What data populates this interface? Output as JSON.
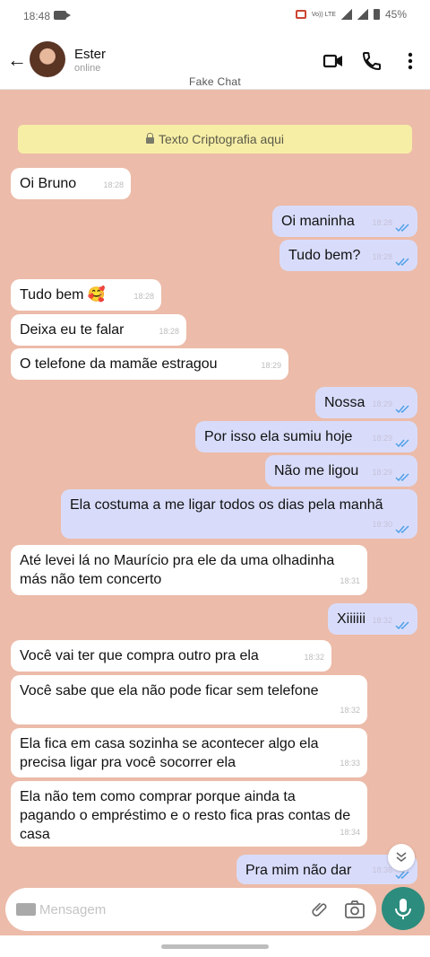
{
  "status_bar": {
    "time": "18:48",
    "network": "Vo)) LTE",
    "battery": "45%"
  },
  "header": {
    "contact_name": "Ester",
    "contact_status": "online",
    "app_label": "Fake Chat"
  },
  "encryption_banner": "Texto Criptografia aqui",
  "messages": [
    {
      "dir": "in",
      "text": "Oi Bruno",
      "time": "18:28"
    },
    {
      "dir": "out",
      "text": "Oi maninha",
      "time": "18:28"
    },
    {
      "dir": "out",
      "text": "Tudo bem?",
      "time": "18:28"
    },
    {
      "dir": "in",
      "text": "Tudo bem 🥰",
      "time": "18:28"
    },
    {
      "dir": "in",
      "text": "Deixa eu te falar",
      "time": "18:28"
    },
    {
      "dir": "in",
      "text": "O telefone da mamãe estragou",
      "time": "18:29"
    },
    {
      "dir": "out",
      "text": "Nossa",
      "time": "18:29"
    },
    {
      "dir": "out",
      "text": "Por isso ela sumiu hoje",
      "time": "18:29"
    },
    {
      "dir": "out",
      "text": "Não me ligou",
      "time": "18:29"
    },
    {
      "dir": "out",
      "text": "Ela costuma a me ligar todos os dias pela manhã",
      "time": "18:30"
    },
    {
      "dir": "in",
      "text": "Até levei lá no Maurício pra ele da uma olhadinha más não tem concerto",
      "time": "18:31"
    },
    {
      "dir": "out",
      "text": "Xiiiiii",
      "time": "18:32"
    },
    {
      "dir": "in",
      "text": "Você vai ter que compra outro pra ela",
      "time": "18:32"
    },
    {
      "dir": "in",
      "text": "Você sabe que ela não pode ficar sem telefone",
      "time": "18:32"
    },
    {
      "dir": "in",
      "text": "Ela fica em casa sozinha se acontecer algo ela precisa ligar pra você socorrer ela",
      "time": "18:33"
    },
    {
      "dir": "in",
      "text": "Ela não tem como comprar porque ainda ta pagando o empréstimo e o resto fica pras contas de casa",
      "time": "18:34"
    },
    {
      "dir": "out",
      "text": "Pra mim não dar",
      "time": "18:36"
    }
  ],
  "composer": {
    "placeholder": "Mensagem"
  },
  "icons": {
    "back": "arrow-left-icon",
    "video": "video-call-icon",
    "call": "phone-icon",
    "menu": "more-vert-icon",
    "keyboard": "keyboard-icon",
    "attach": "paperclip-icon",
    "camera": "camera-icon",
    "mic": "mic-icon",
    "scroll": "chevron-double-down-icon",
    "lock": "lock-icon",
    "read": "double-check-icon"
  },
  "colors": {
    "chat_bg": "#ecbba9",
    "incoming": "#ffffff",
    "outgoing": "#d8dcfa",
    "banner": "#f7eea6",
    "mic": "#2c8c7e",
    "ticks": "#4a9ee8"
  }
}
